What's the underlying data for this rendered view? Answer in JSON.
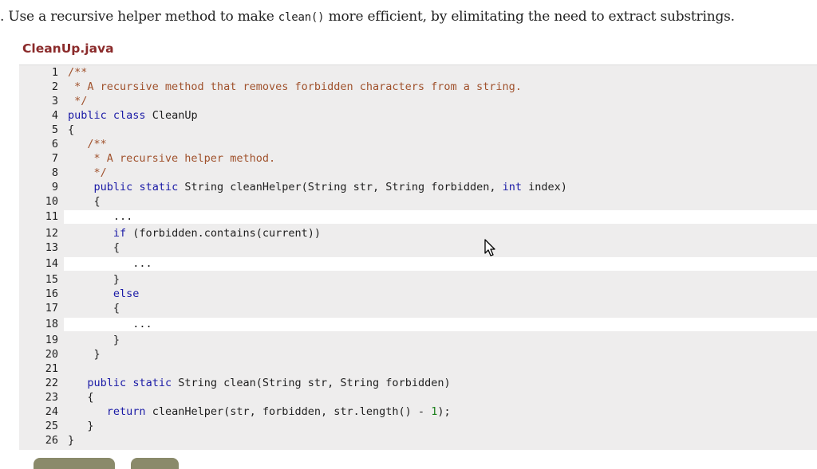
{
  "prompt": {
    "pre": ". Use a recursive helper method to make ",
    "code": "clean()",
    "post": " more efficient, by elimitating the need to extract substrings."
  },
  "file": {
    "name": "CleanUp.java"
  },
  "code": {
    "lines": [
      {
        "n": "1",
        "t": "/**"
      },
      {
        "n": "2",
        "t": " * A recursive method that removes forbidden characters from a string."
      },
      {
        "n": "3",
        "t": " */"
      },
      {
        "n": "4",
        "t": "public class CleanUp"
      },
      {
        "n": "5",
        "t": "{"
      },
      {
        "n": "6",
        "t": "   /**"
      },
      {
        "n": "7",
        "t": "    * A recursive helper method."
      },
      {
        "n": "8",
        "t": "    */"
      },
      {
        "n": "9",
        "t": "    public static String cleanHelper(String str, String forbidden, int index)"
      },
      {
        "n": "10",
        "t": "    {"
      },
      {
        "n": "11",
        "t": "       ..."
      },
      {
        "n": "12",
        "t": "       if (forbidden.contains(current))"
      },
      {
        "n": "13",
        "t": "       {"
      },
      {
        "n": "14",
        "t": "          ..."
      },
      {
        "n": "15",
        "t": "       }"
      },
      {
        "n": "16",
        "t": "       else"
      },
      {
        "n": "17",
        "t": "       {"
      },
      {
        "n": "18",
        "t": "          ..."
      },
      {
        "n": "19",
        "t": "       }"
      },
      {
        "n": "20",
        "t": "    }"
      },
      {
        "n": "21",
        "t": ""
      },
      {
        "n": "22",
        "t": "   public static String clean(String str, String forbidden)"
      },
      {
        "n": "23",
        "t": "   {"
      },
      {
        "n": "24",
        "t": "      return cleanHelper(str, forbidden, str.length() - 1);"
      },
      {
        "n": "25",
        "t": "   }"
      },
      {
        "n": "26",
        "t": "}"
      }
    ],
    "editable_lines": [
      11,
      14,
      18
    ]
  },
  "colors": {
    "filename": "#8b2b2b",
    "keyword": "#1a1aa6",
    "comment": "#a0522d",
    "number": "#1a7f1a",
    "editor_bg": "#eeeded"
  },
  "icons": {
    "cursor": "mouse-pointer-icon"
  }
}
